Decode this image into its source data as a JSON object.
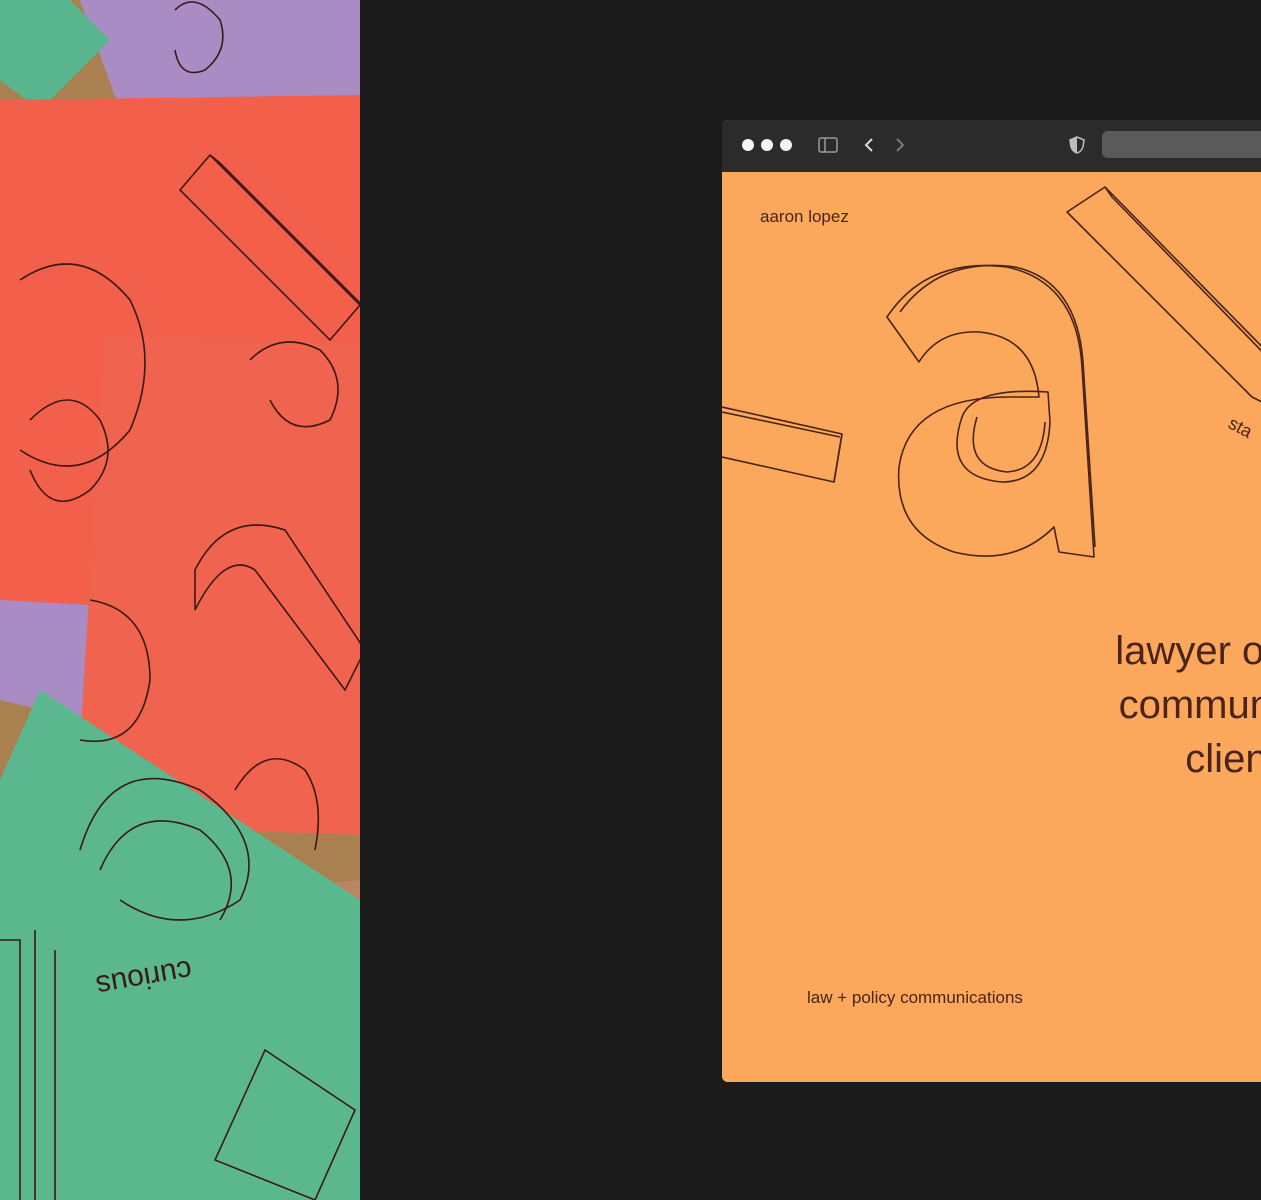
{
  "photo": {
    "card_word": "curious",
    "colors": {
      "red": "#f25f4b",
      "green": "#59b58d",
      "purple": "#a98cc4",
      "cork": "#a9804f",
      "ink": "#3a1a14"
    }
  },
  "browser": {
    "toolbar": {
      "window_controls": [
        "close",
        "minimize",
        "zoom"
      ],
      "sidebar_icon": "sidebar-icon",
      "back_icon": "chevron-left-icon",
      "forward_icon": "chevron-right-icon",
      "privacy_icon": "shield-icon"
    },
    "page": {
      "name": "aaron lopez",
      "headline": [
        "lawyer optimiz",
        "communicatio",
        "clients"
      ],
      "tagline": "law + policy communications",
      "artwork_fragment": "sta",
      "colors": {
        "background": "#fba85c",
        "text": "#4a2418"
      }
    }
  }
}
